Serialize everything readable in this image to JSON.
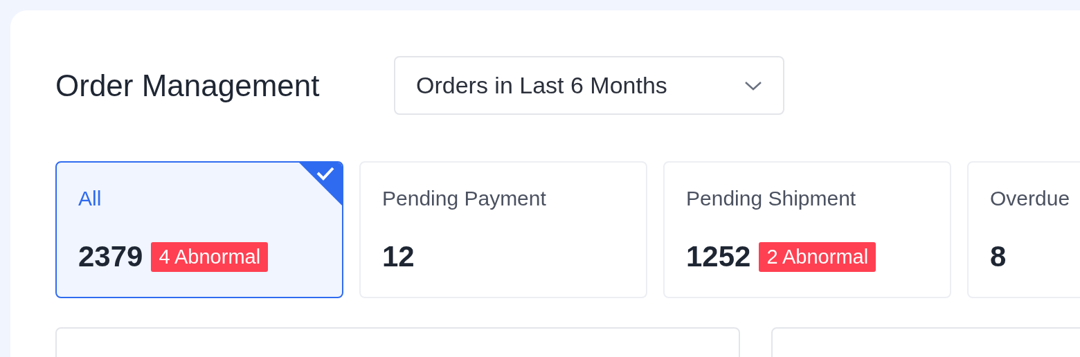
{
  "header": {
    "title": "Order Management",
    "period_dropdown": {
      "value": "Orders in Last 6 Months"
    }
  },
  "status_cards": [
    {
      "label": "All",
      "count": "2379",
      "badge": "4 Abnormal",
      "selected": true
    },
    {
      "label": "Pending Payment",
      "count": "12",
      "selected": false
    },
    {
      "label": "Pending Shipment",
      "count": "1252",
      "badge": "2 Abnormal",
      "selected": false
    },
    {
      "label": "Overdue",
      "count": "8",
      "selected": false
    }
  ]
}
